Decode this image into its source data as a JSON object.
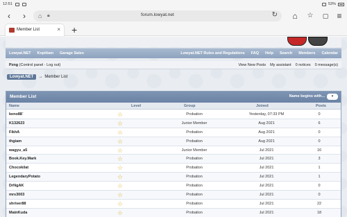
{
  "status": {
    "time": "12:51",
    "battery": "53%"
  },
  "browser": {
    "url": "forum.lowyat.net",
    "tab_title": "Member List",
    "tab_close": "×",
    "newtab": "+"
  },
  "forum": {
    "nav_left": [
      "Lowyat.NET",
      "Kopitiam",
      "Garage Sales"
    ],
    "nav_right": [
      "Lowyat.NET Rules and Regulations",
      "FAQ",
      "Help",
      "Search",
      "Members",
      "Calendar"
    ],
    "user": {
      "name": "Pzng",
      "control": "(Control panel · Log out)"
    },
    "user_links": [
      "View New Posts",
      "My assistant",
      "0 notices",
      "0 message(s)"
    ],
    "breadcrumb": {
      "home": "Lowyat.NET",
      "sep": "→",
      "current": "Member List"
    }
  },
  "member_list": {
    "title": "Member List",
    "begins_with_label": "Name begins with...",
    "begins_with_value": "",
    "columns": {
      "name": "Name",
      "level": "Level",
      "group": "Group",
      "joined": "Joined",
      "posts": "Posts"
    },
    "rows": [
      {
        "name": "keno88`",
        "group": "Probation",
        "joined": "Yesterday, 07:33 PM",
        "posts": "0"
      },
      {
        "name": "K132623",
        "group": "Junior Member",
        "joined": "Aug 2021",
        "posts": "6"
      },
      {
        "name": "FikhA",
        "group": "Probation",
        "joined": "Aug 2021",
        "posts": "0"
      },
      {
        "name": "thgiam",
        "group": "Probation",
        "joined": "Aug 2021",
        "posts": "0"
      },
      {
        "name": "wagyu_a5",
        "group": "Junior Member",
        "joined": "Jul 2021",
        "posts": "16"
      },
      {
        "name": "Book.Key.Mark",
        "group": "Probation",
        "joined": "Jul 2021",
        "posts": "3"
      },
      {
        "name": "Chocokilat",
        "group": "Probation",
        "joined": "Jul 2021",
        "posts": "1"
      },
      {
        "name": "LegendaryPotato",
        "group": "Probation",
        "joined": "Jul 2021",
        "posts": "1"
      },
      {
        "name": "DrNgAK",
        "group": "Probation",
        "joined": "Jul 2021",
        "posts": "0"
      },
      {
        "name": "mrs3003",
        "group": "Probation",
        "joined": "Jul 2021",
        "posts": "0"
      },
      {
        "name": "shriver88",
        "group": "Probation",
        "joined": "Jul 2021",
        "posts": "22"
      },
      {
        "name": "MainKuda",
        "group": "Probation",
        "joined": "Jul 2021",
        "posts": "18"
      }
    ]
  },
  "colors": {
    "nav": "#8ea3bf",
    "header": "#6a82a4",
    "star": "#d8ad2a"
  }
}
